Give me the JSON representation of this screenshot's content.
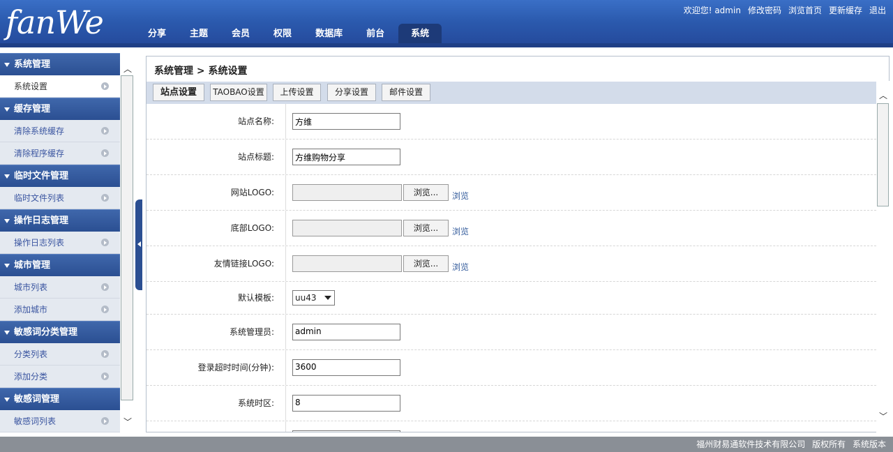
{
  "app": {
    "logo_text": "fanWe"
  },
  "nav": {
    "tabs": [
      {
        "label": "分享"
      },
      {
        "label": "主题"
      },
      {
        "label": "会员"
      },
      {
        "label": "权限"
      },
      {
        "label": "数据库"
      },
      {
        "label": "前台"
      },
      {
        "label": "系统",
        "active": true
      }
    ]
  },
  "toplinks": {
    "welcome": "欢迎您! admin",
    "change_password": "修改密码",
    "browse_home": "浏览首页",
    "update_cache": "更新缓存",
    "logout": "退出"
  },
  "sidebar": {
    "groups": [
      {
        "title": "系统管理",
        "items": [
          {
            "label": "系统设置",
            "active": true
          }
        ]
      },
      {
        "title": "缓存管理",
        "items": [
          {
            "label": "清除系统缓存"
          },
          {
            "label": "清除程序缓存"
          }
        ]
      },
      {
        "title": "临时文件管理",
        "items": [
          {
            "label": "临时文件列表"
          }
        ]
      },
      {
        "title": "操作日志管理",
        "items": [
          {
            "label": "操作日志列表"
          }
        ]
      },
      {
        "title": "城市管理",
        "items": [
          {
            "label": "城市列表"
          },
          {
            "label": "添加城市"
          }
        ]
      },
      {
        "title": "敏感词分类管理",
        "items": [
          {
            "label": "分类列表"
          },
          {
            "label": "添加分类"
          }
        ]
      },
      {
        "title": "敏感词管理",
        "items": [
          {
            "label": "敏感词列表"
          }
        ]
      }
    ]
  },
  "main": {
    "breadcrumb": "系统管理 > 系统设置",
    "toolbar": {
      "site_settings": "站点设置",
      "taobao_settings": "TAOBAO设置",
      "upload_settings": "上传设置",
      "share_settings": "分享设置",
      "mail_settings": "邮件设置"
    },
    "form": {
      "site_name": {
        "label": "站点名称:",
        "value": "方维"
      },
      "site_title": {
        "label": "站点标题:",
        "value": "方维购物分享"
      },
      "site_logo": {
        "label": "网站LOGO:",
        "button": "浏览...",
        "link": "浏览"
      },
      "footer_logo": {
        "label": "底部LOGO:",
        "button": "浏览...",
        "link": "浏览"
      },
      "friend_logo": {
        "label": "友情链接LOGO:",
        "button": "浏览...",
        "link": "浏览"
      },
      "default_template": {
        "label": "默认模板:",
        "value": "uu43"
      },
      "admin_name": {
        "label": "系统管理员:",
        "value": "admin"
      },
      "login_timeout": {
        "label": "登录超时时间(分钟):",
        "value": "3600"
      },
      "timezone": {
        "label": "系统时区:",
        "value": "8"
      }
    }
  },
  "footer": {
    "company": "福州财易通软件技术有限公司",
    "rights": "版权所有",
    "version": "系统版本"
  }
}
